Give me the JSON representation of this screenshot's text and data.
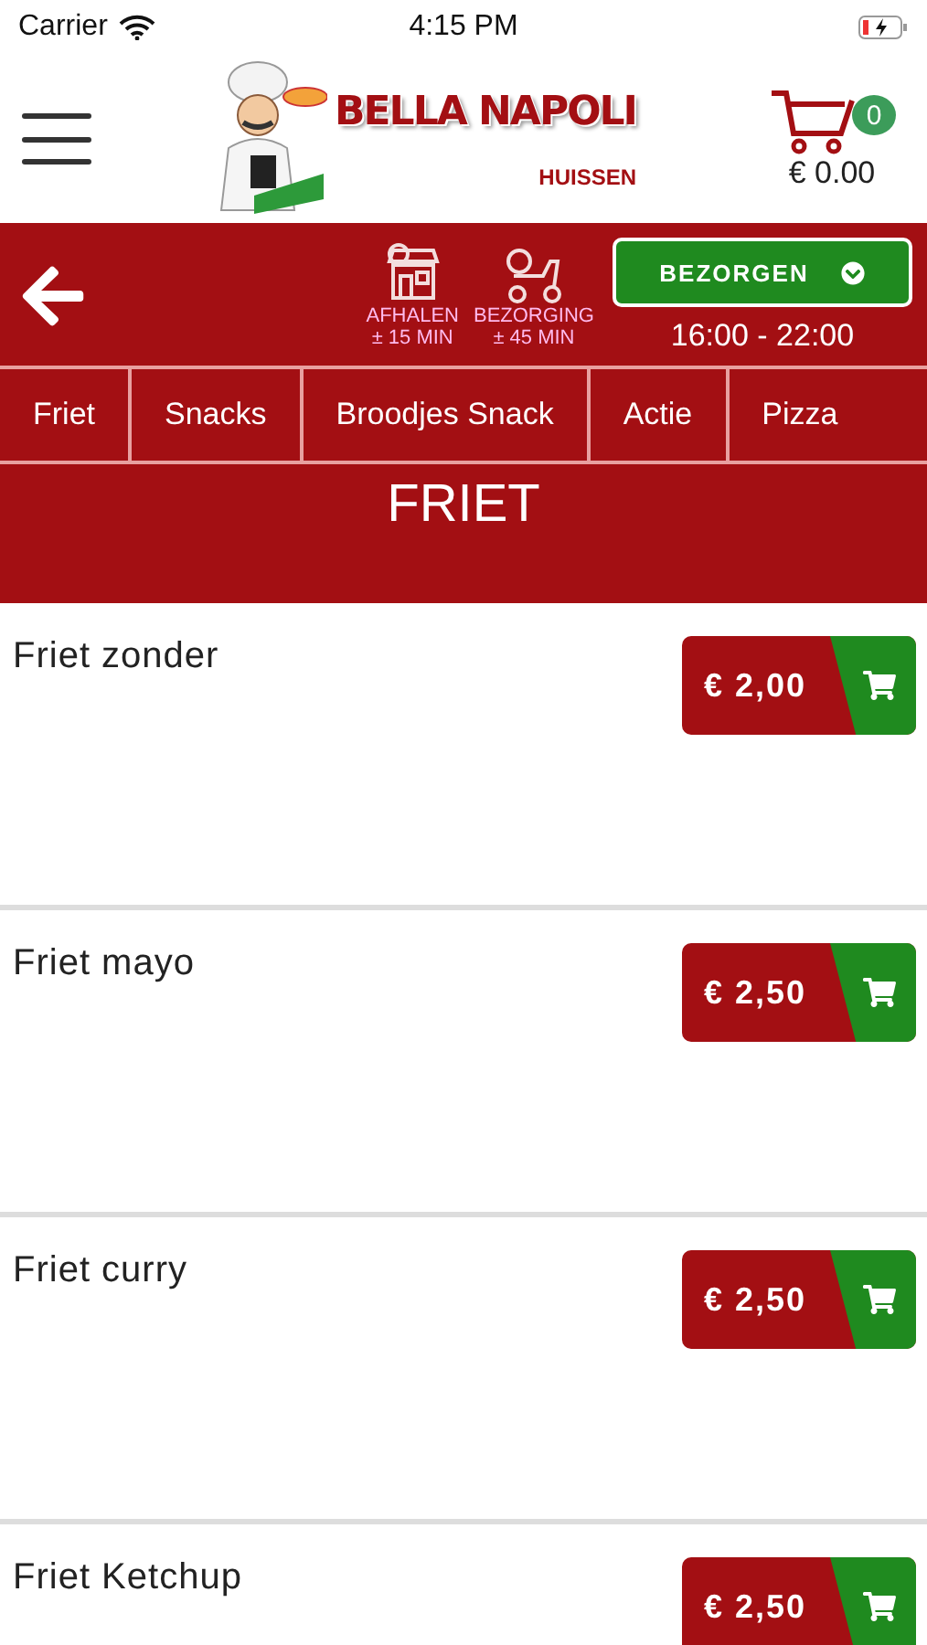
{
  "status_bar": {
    "carrier": "Carrier",
    "time": "4:15 PM"
  },
  "header": {
    "brand": "BELLA NAPOLI",
    "location": "HUISSEN",
    "cart_count": "0",
    "cart_total": "€ 0.00"
  },
  "order_bar": {
    "pickup": {
      "label": "AFHALEN",
      "time": "± 15 MIN"
    },
    "delivery": {
      "label": "BEZORGING",
      "time": "± 45 MIN"
    },
    "mode": "BEZORGEN",
    "hours": "16:00 - 22:00"
  },
  "categories": [
    {
      "label": "Friet"
    },
    {
      "label": "Snacks"
    },
    {
      "label": "Broodjes Snack"
    },
    {
      "label": "Actie"
    },
    {
      "label": "Pizza"
    }
  ],
  "section_title": "FRIET",
  "products": [
    {
      "name": "Friet zonder",
      "price": "€ 2,00"
    },
    {
      "name": "Friet mayo",
      "price": "€ 2,50"
    },
    {
      "name": "Friet curry",
      "price": "€ 2,50"
    },
    {
      "name": "Friet Ketchup",
      "price": "€ 2,50"
    }
  ]
}
